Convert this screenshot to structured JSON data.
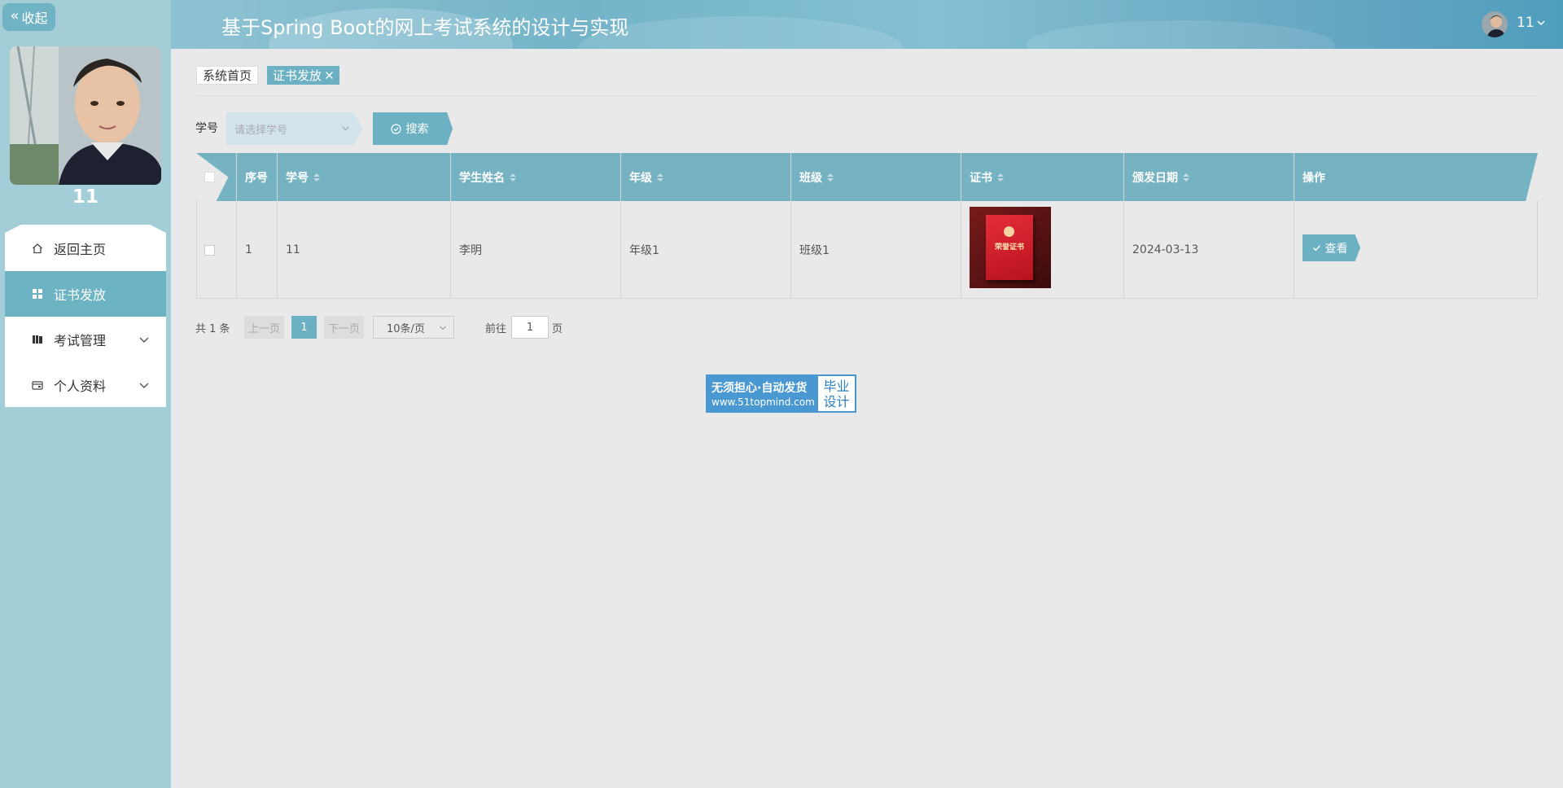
{
  "sidebar": {
    "collapse_label": "收起",
    "username": "11",
    "menu": [
      {
        "label": "返回主页",
        "icon": "home-icon"
      },
      {
        "label": "证书发放",
        "icon": "grid-icon"
      },
      {
        "label": "考试管理",
        "icon": "book-icon"
      },
      {
        "label": "个人资料",
        "icon": "wallet-icon"
      }
    ]
  },
  "header": {
    "title": "基于Spring Boot的网上考试系统的设计与实现",
    "user": "11"
  },
  "tabs": {
    "home": "系统首页",
    "current": "证书发放"
  },
  "search": {
    "label": "学号",
    "placeholder": "请选择学号",
    "button": "搜索"
  },
  "table": {
    "columns": [
      "序号",
      "学号",
      "学生姓名",
      "年级",
      "班级",
      "证书",
      "颁发日期",
      "操作"
    ],
    "rows": [
      {
        "index": "1",
        "student_id": "11",
        "name": "李明",
        "grade": "年级1",
        "class": "班级1",
        "certificate_text": "荣誉证书",
        "date": "2024-03-13",
        "action": "查看"
      }
    ]
  },
  "pagination": {
    "total": "共 1 条",
    "prev": "上一页",
    "current": "1",
    "next": "下一页",
    "page_size": "10条/页",
    "goto_label": "前往",
    "goto_value": "1",
    "goto_suffix": "页"
  },
  "badge": {
    "line1": "无须担心·自动发货",
    "line2": "www.51topmind.com",
    "right1": "毕业",
    "right2": "设计"
  },
  "colors": {
    "accent": "#6cb0c3",
    "sidebar_bg": "#a3cdd7",
    "header_bg": "#74b4c9",
    "table_header": "#76b3c2",
    "badge_blue": "#4a98d2"
  }
}
